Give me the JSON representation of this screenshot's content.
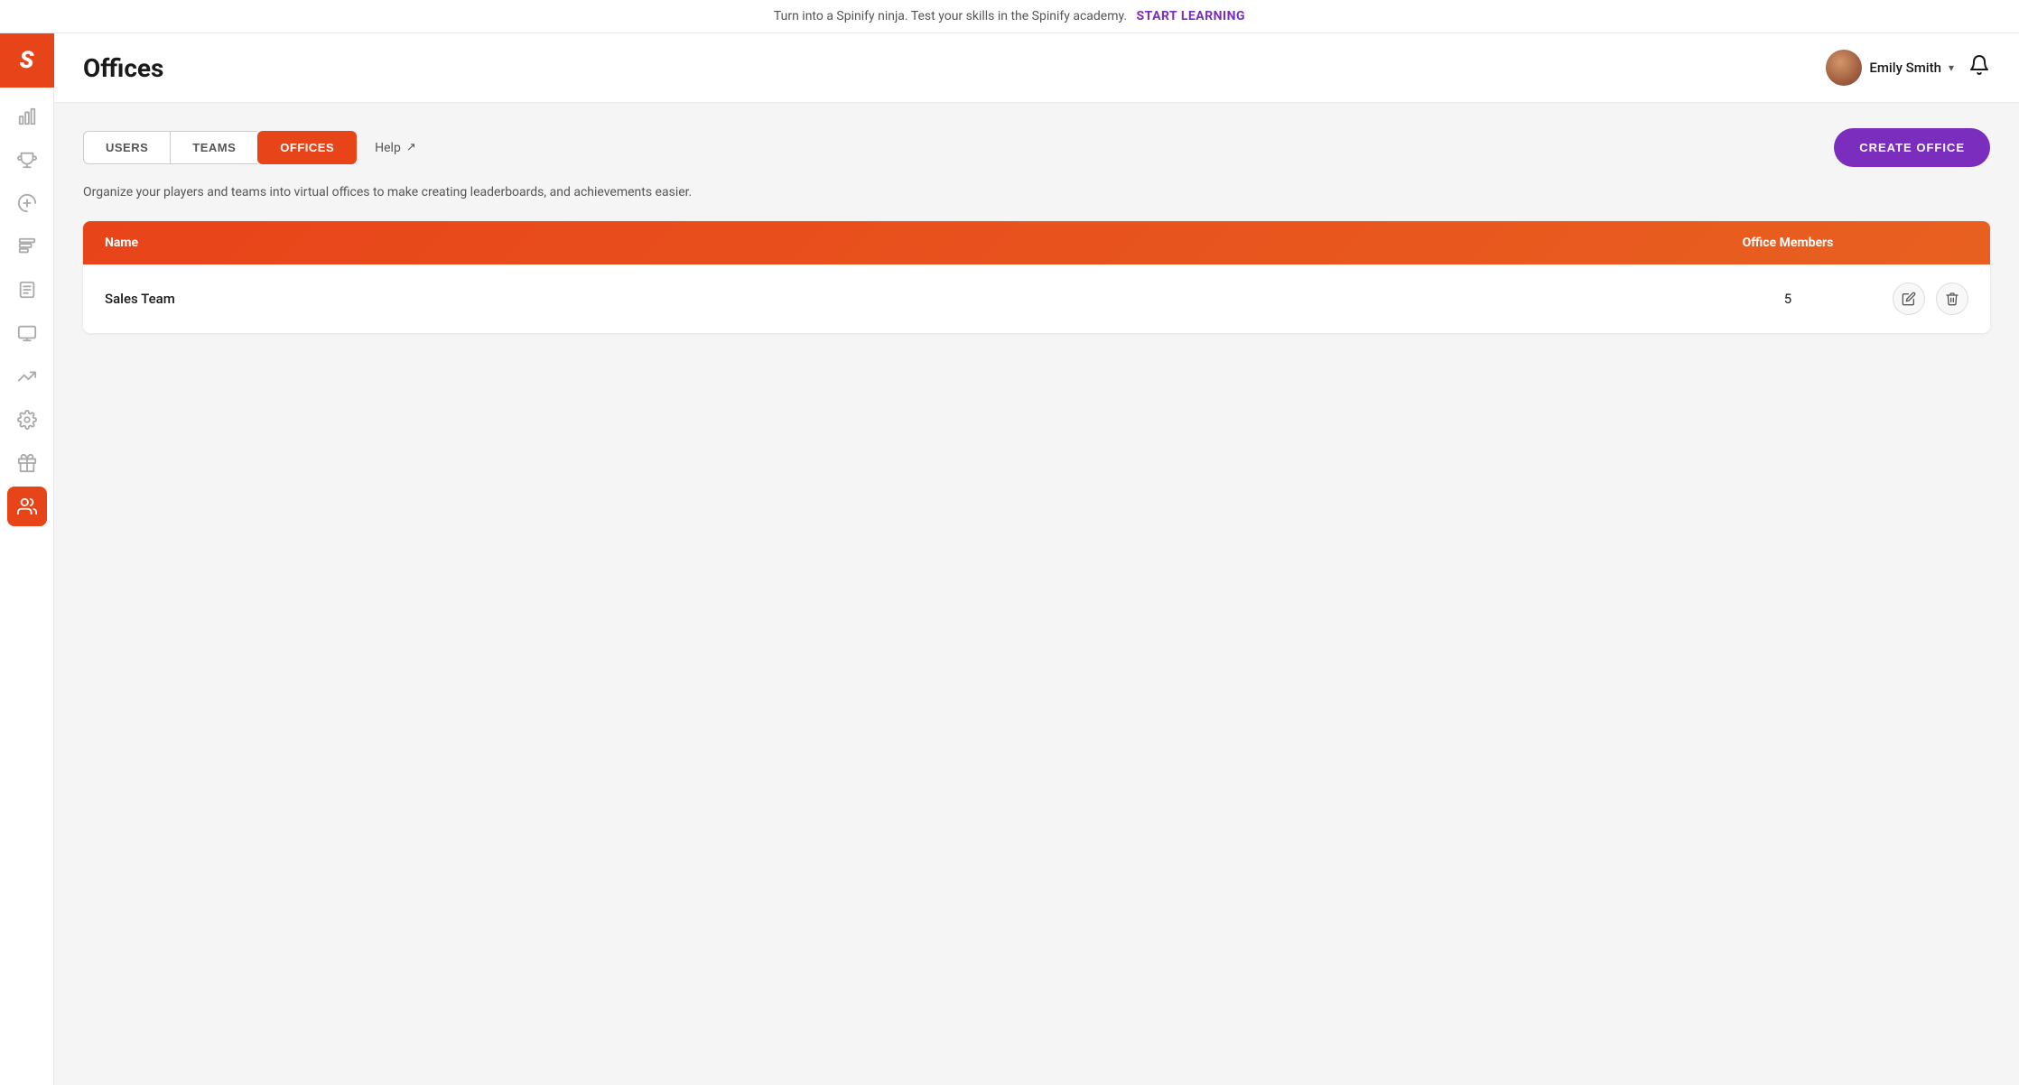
{
  "banner": {
    "text": "Turn into a Spinify ninja. Test your skills in the Spinify academy.",
    "cta_label": "START LEARNING"
  },
  "sidebar": {
    "logo": "S",
    "items": [
      {
        "id": "analytics",
        "icon": "📊",
        "label": "Analytics"
      },
      {
        "id": "trophy",
        "icon": "🏆",
        "label": "Trophy"
      },
      {
        "id": "megaphone",
        "icon": "📣",
        "label": "Announcements"
      },
      {
        "id": "leaderboard",
        "icon": "📋",
        "label": "Leaderboard"
      },
      {
        "id": "notes",
        "icon": "📄",
        "label": "Notes"
      },
      {
        "id": "monitor",
        "icon": "🖥",
        "label": "Monitor"
      },
      {
        "id": "chart",
        "icon": "📈",
        "label": "Chart"
      },
      {
        "id": "settings-advanced",
        "icon": "⚙",
        "label": "Settings"
      },
      {
        "id": "gift",
        "icon": "🎁",
        "label": "Gift"
      },
      {
        "id": "users",
        "icon": "👥",
        "label": "Users",
        "active": true
      }
    ]
  },
  "header": {
    "title": "Offices",
    "user_name": "Emily Smith",
    "user_chevron": "▾"
  },
  "tabs": {
    "items": [
      {
        "id": "users",
        "label": "USERS"
      },
      {
        "id": "teams",
        "label": "TEAMS"
      },
      {
        "id": "offices",
        "label": "OFFICES",
        "active": true
      }
    ],
    "help_label": "Help",
    "create_button_label": "CREATE OFFICE"
  },
  "description": "Organize your players and teams into virtual offices to make creating leaderboards, and achievements easier.",
  "table": {
    "columns": [
      {
        "id": "name",
        "label": "Name"
      },
      {
        "id": "members",
        "label": "Office Members"
      }
    ],
    "rows": [
      {
        "name": "Sales Team",
        "members": "5"
      }
    ]
  }
}
